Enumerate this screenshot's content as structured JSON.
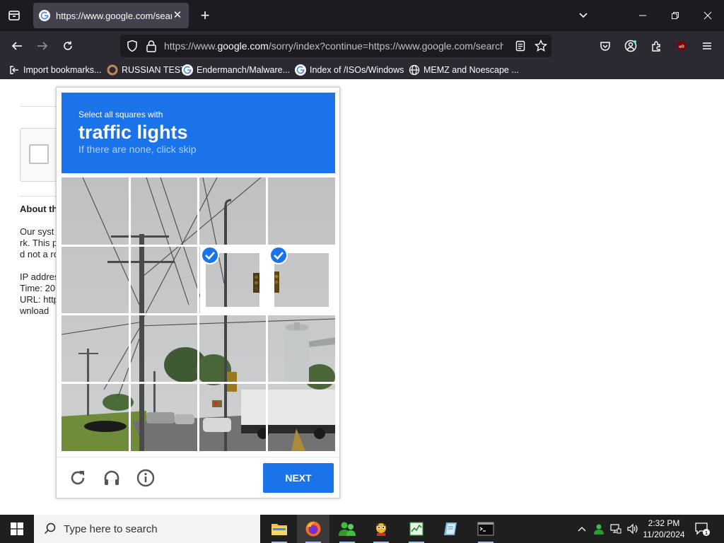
{
  "browser": {
    "tab": {
      "title": "https://www.google.com/search"
    },
    "url": {
      "prefix": "https://www.",
      "domain": "google.com",
      "rest": "/sorry/index?continue=https://www.google.com/search"
    },
    "bookmarks": [
      {
        "label": "Import bookmarks..."
      },
      {
        "label": "RUSSIAN TEST"
      },
      {
        "label": "Endermanch/Malware..."
      },
      {
        "label": "Index of /ISOs/Windows"
      },
      {
        "label": "MEMZ and Noescape ..."
      }
    ]
  },
  "page": {
    "heading": "About th",
    "lines": [
      "Our syst",
      "rk. This p",
      "d not a ro"
    ],
    "info": [
      "IP addres",
      "Time: 20",
      "URL: http",
      "wnload"
    ]
  },
  "captcha": {
    "instruction": "Select all squares with",
    "target": "traffic lights",
    "hint": "If there are none, click skip",
    "selected_tiles": [
      7,
      8
    ],
    "next_label": "NEXT"
  },
  "taskbar": {
    "search_placeholder": "Type here to search",
    "time": "2:32 PM",
    "date": "11/20/2024"
  }
}
